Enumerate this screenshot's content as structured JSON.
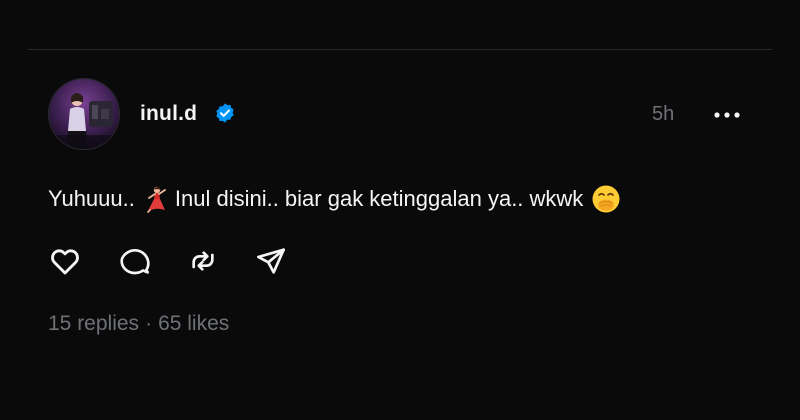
{
  "post": {
    "author": {
      "username": "inul.d",
      "verified": true,
      "avatar_icon": "profile-photo"
    },
    "time_ago": "5h",
    "more_icon": "more-horizontal-icon",
    "text": {
      "part1": "Yuhuuu..",
      "emoji1": "dancer-emoji",
      "part2": "Inul disini.. biar gak ketinggalan ya.. wkwk",
      "emoji2": "face-with-open-eyes-and-hand-over-mouth-emoji"
    },
    "actions": [
      {
        "icon": "heart-icon",
        "label": "Like"
      },
      {
        "icon": "comment-icon",
        "label": "Reply"
      },
      {
        "icon": "repost-icon",
        "label": "Repost"
      },
      {
        "icon": "share-icon",
        "label": "Share"
      }
    ],
    "stats": {
      "replies": "15 replies",
      "separator": "·",
      "likes": "65 likes"
    }
  },
  "colors": {
    "background": "#0a0a0b",
    "text": "#f3f5f7",
    "muted": "#6e7277",
    "verified": "#0095f6"
  }
}
